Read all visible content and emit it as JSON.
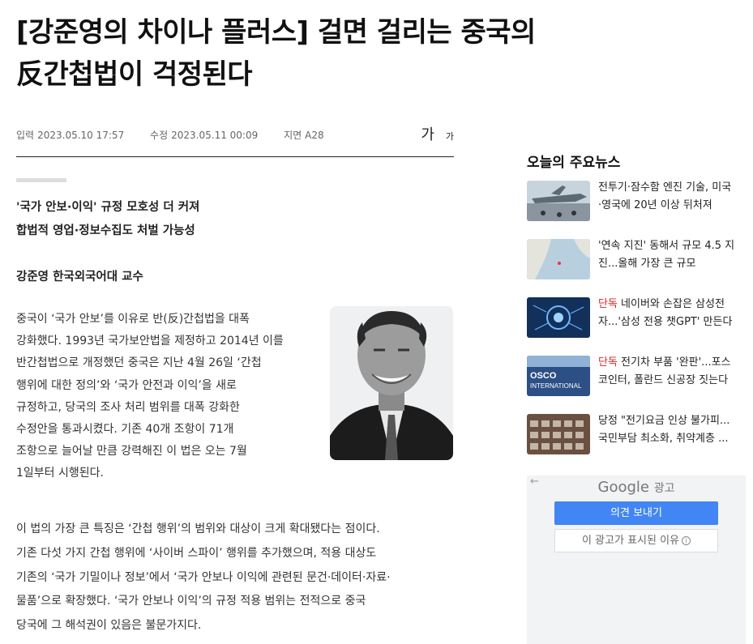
{
  "article": {
    "title_line1": "[강준영의 차이나 플러스] 걸면 걸리는 중국의",
    "title_line2": "反간첩법이 걱정된다",
    "meta": {
      "input_label": "입력",
      "input_date": "2023.05.10 17:57",
      "edit_label": "수정",
      "edit_date": "2023.05.11 00:09",
      "page_label": "지면",
      "page_value": "A28",
      "font_big": "가",
      "font_small": "가"
    },
    "subheads": [
      "'국가 안보·이익' 규정 모호성 더 커져",
      "합법적 영업·정보수집도 처벌 가능성"
    ],
    "author": "강준영 한국외국어대 교수",
    "p1_lines": [
      "중국이 ‘국가 안보’를 이유로 반(反)간첩법을 대폭",
      "강화했다. 1993년 국가보안법을 제정하고 2014년 이를",
      "반간첩법으로 개정했던 중국은 지난 4월 26일 ‘간첩",
      "행위에 대한 정의’와 ‘국가 안전과 이익’을 새로",
      "규정하고, 당국의 조사 처리 범위를 대폭 강화한",
      "수정안을 통과시켰다. 기존 40개 조항이 71개",
      "조항으로 늘어날 만큼 강력해진 이 법은 오는 7월",
      "1일부터 시행된다."
    ],
    "p2_lines": [
      "이 법의 가장 큰 특징은 ‘간첩 행위’의 범위와 대상이 크게 확대됐다는 점이다.",
      "기존 다섯 가지 간첩 행위에 ‘사이버 스파이’ 행위를 추가했으며, 적용 대상도",
      "기존의 ‘국가 기밀이나 정보’에서 ‘국가 안보나 이익에 관련된 문건·데이터·자료·",
      "물품’으로 확장했다. ‘국가 안보나 이익’의 규정 적용 범위는 전적으로 중국",
      "당국에 그 해석권이 있음은 불문가지다."
    ]
  },
  "sidebar": {
    "title": "오늘의 주요뉴스",
    "items": [
      {
        "tag": "",
        "line1": "전투기·잠수함 엔진 기술, 미국",
        "line2": "·영국에 20년 이상 뒤처져"
      },
      {
        "tag": "",
        "line1": "'연속 지진' 동해서 규모 4.5 지",
        "line2": "진...올해 가장 큰 규모"
      },
      {
        "tag": "단독",
        "line1": " 네이버와 손잡은 삼성전",
        "line2": "자...'삼성 전용 챗GPT' 만든다"
      },
      {
        "tag": "단독",
        "line1": " 전기차 부품 '완판'...포스",
        "line2": "코인터, 폴란드 신공장 짓는다"
      },
      {
        "tag": "",
        "line1": "당정 \"전기요금 인상 불가피...",
        "line2": "국민부담 최소화, 취약계층 ..."
      }
    ],
    "thumb3_text": "OSCO\nINTERNATIONAL"
  },
  "ad": {
    "back": "←",
    "google": "Google",
    "label": "광고",
    "feedback_button": "의견 보내기",
    "why_button": "이 광고가 표시된 이유",
    "info_icon": "i"
  },
  "colors": {
    "tag": "#d22222",
    "button_blue": "#4285f4",
    "ad_bg": "#f1f3f4"
  }
}
